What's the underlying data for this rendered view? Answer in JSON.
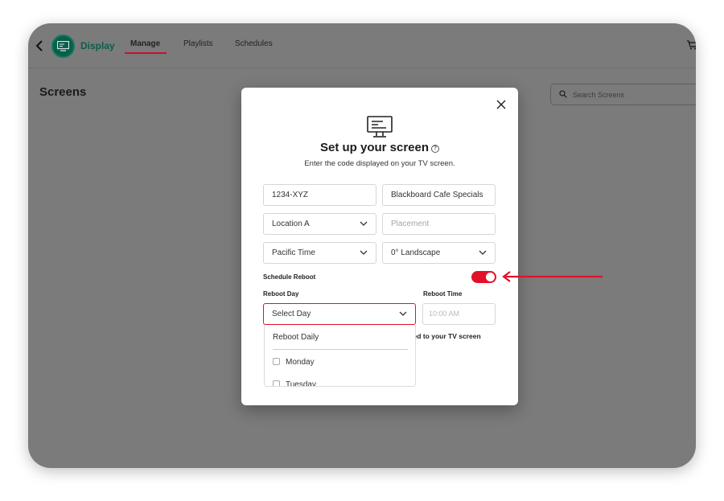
{
  "nav": {
    "app_name": "Display",
    "tabs": [
      {
        "label": "Manage"
      },
      {
        "label": "Playlists"
      },
      {
        "label": "Schedules"
      }
    ]
  },
  "page": {
    "title": "Screens",
    "search_placeholder": "Search Screens"
  },
  "modal": {
    "title": "Set up your screen",
    "help_glyph": "?",
    "subtitle": "Enter the code displayed on your TV screen.",
    "code_value": "1234-XYZ",
    "name_value": "Blackboard Cafe Specials",
    "location_value": "Location A",
    "placement_placeholder": "Placement",
    "timezone_value": "Pacific Time",
    "orientation_value": "0° Landscape",
    "schedule_reboot_label": "Schedule Reboot",
    "schedule_reboot_on": true,
    "reboot_day_label": "Reboot Day",
    "reboot_time_label": "Reboot Time",
    "reboot_day_value": "Select Day",
    "reboot_time_placeholder": "10:00 AM",
    "note_partial": "cted to your TV screen",
    "dropdown": {
      "daily": "Reboot Daily",
      "days": [
        "Monday",
        "Tuesday"
      ]
    }
  },
  "colors": {
    "accent_red": "#e3102a",
    "brand_green": "#0b5e4a"
  }
}
